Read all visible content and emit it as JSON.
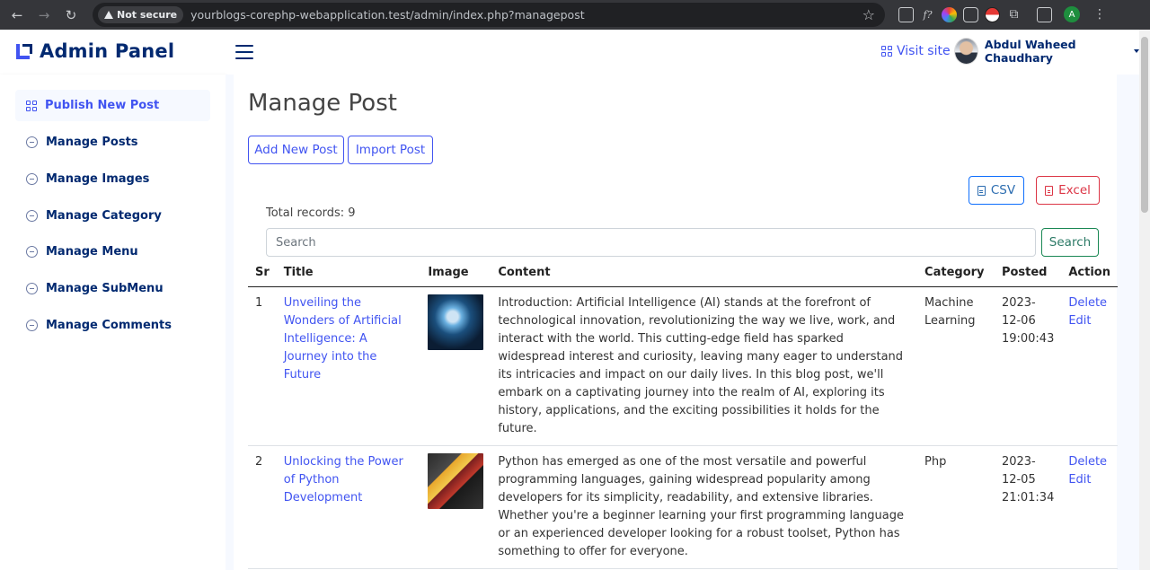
{
  "browser": {
    "security_label": "Not secure",
    "url": "yourblogs-corephp-webapplication.test/admin/index.php?managepost",
    "profile_initial": "A",
    "icons": [
      "back-icon",
      "forward-icon",
      "reload-icon",
      "star-icon",
      "image-ext-icon",
      "formula-ext-icon",
      "color-ext-icon",
      "glasses-ext-icon",
      "pokeball-ext-icon",
      "extensions-icon",
      "sidepanel-icon",
      "menu-icon"
    ]
  },
  "topbar": {
    "brand": "Admin Panel",
    "visit_site": "Visit site",
    "user_name": "Abdul Waheed Chaudhary"
  },
  "sidebar": {
    "items": [
      {
        "label": "Publish New Post",
        "icon": "grid-icon",
        "active": true
      },
      {
        "label": "Manage Posts",
        "icon": "circle-minus-icon"
      },
      {
        "label": "Manage Images",
        "icon": "circle-minus-icon"
      },
      {
        "label": "Manage Category",
        "icon": "circle-minus-icon"
      },
      {
        "label": "Manage Menu",
        "icon": "circle-minus-icon"
      },
      {
        "label": "Manage SubMenu",
        "icon": "circle-minus-icon"
      },
      {
        "label": "Manage Comments",
        "icon": "circle-minus-icon"
      }
    ]
  },
  "main": {
    "title": "Manage Post",
    "add_button": "Add New Post",
    "import_button": "Import Post",
    "csv_button": "CSV",
    "excel_button": "Excel",
    "total_records": "Total records: 9",
    "search_placeholder": "Search",
    "search_button": "Search",
    "columns": [
      "Sr",
      "Title",
      "Image",
      "Content",
      "Category",
      "Posted",
      "Action"
    ],
    "rows": [
      {
        "sr": "1",
        "title": "Unveiling the Wonders of Artificial Intelligence: A Journey into the Future",
        "content": "Introduction: Artificial Intelligence (AI) stands at the forefront of technological innovation, revolutionizing the way we live, work, and interact with the world. This cutting-edge field has sparked widespread interest and curiosity, leaving many eager to understand its intricacies and impact on our daily lives. In this blog post, we'll embark on a captivating journey into the realm of AI, exploring its history, applications, and the exciting possibilities it holds for the future.",
        "category": "Machine Learning",
        "posted_date": "2023-12-06",
        "posted_time": "19:00:43",
        "delete": "Delete",
        "edit": "Edit"
      },
      {
        "sr": "2",
        "title": "Unlocking the Power of Python Development",
        "content": "Python has emerged as one of the most versatile and powerful programming languages, gaining widespread popularity among developers for its simplicity, readability, and extensive libraries. Whether you're a beginner learning your first programming language or an experienced developer looking for a robust toolset, Python has something to offer for everyone.",
        "category": "Php",
        "posted_date": "2023-12-05",
        "posted_time": "21:01:34",
        "delete": "Delete",
        "edit": "Edit"
      }
    ]
  },
  "colors": {
    "accent": "#4154f1",
    "brand": "#012970",
    "danger": "#dc3545",
    "success": "#198754"
  }
}
